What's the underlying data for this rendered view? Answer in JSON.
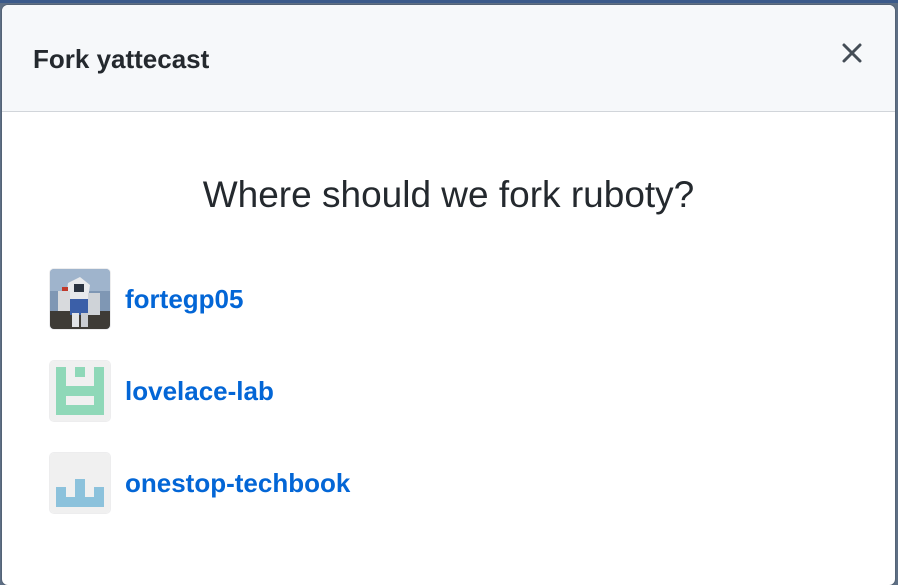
{
  "dialog": {
    "title": "Fork yattecast",
    "close_icon": "x-icon",
    "question": "Where should we fork ruboty?",
    "owners": [
      {
        "name": "fortegp05",
        "avatar_icon": "photo-avatar"
      },
      {
        "name": "lovelace-lab",
        "avatar_icon": "identicon-green"
      },
      {
        "name": "onestop-techbook",
        "avatar_icon": "identicon-blue"
      }
    ]
  },
  "colors": {
    "link": "#0366d6",
    "header_bg": "#f6f8fa",
    "text": "#24292e",
    "identicon_green": "#8fd8b8",
    "identicon_blue": "#8cc2dc"
  }
}
